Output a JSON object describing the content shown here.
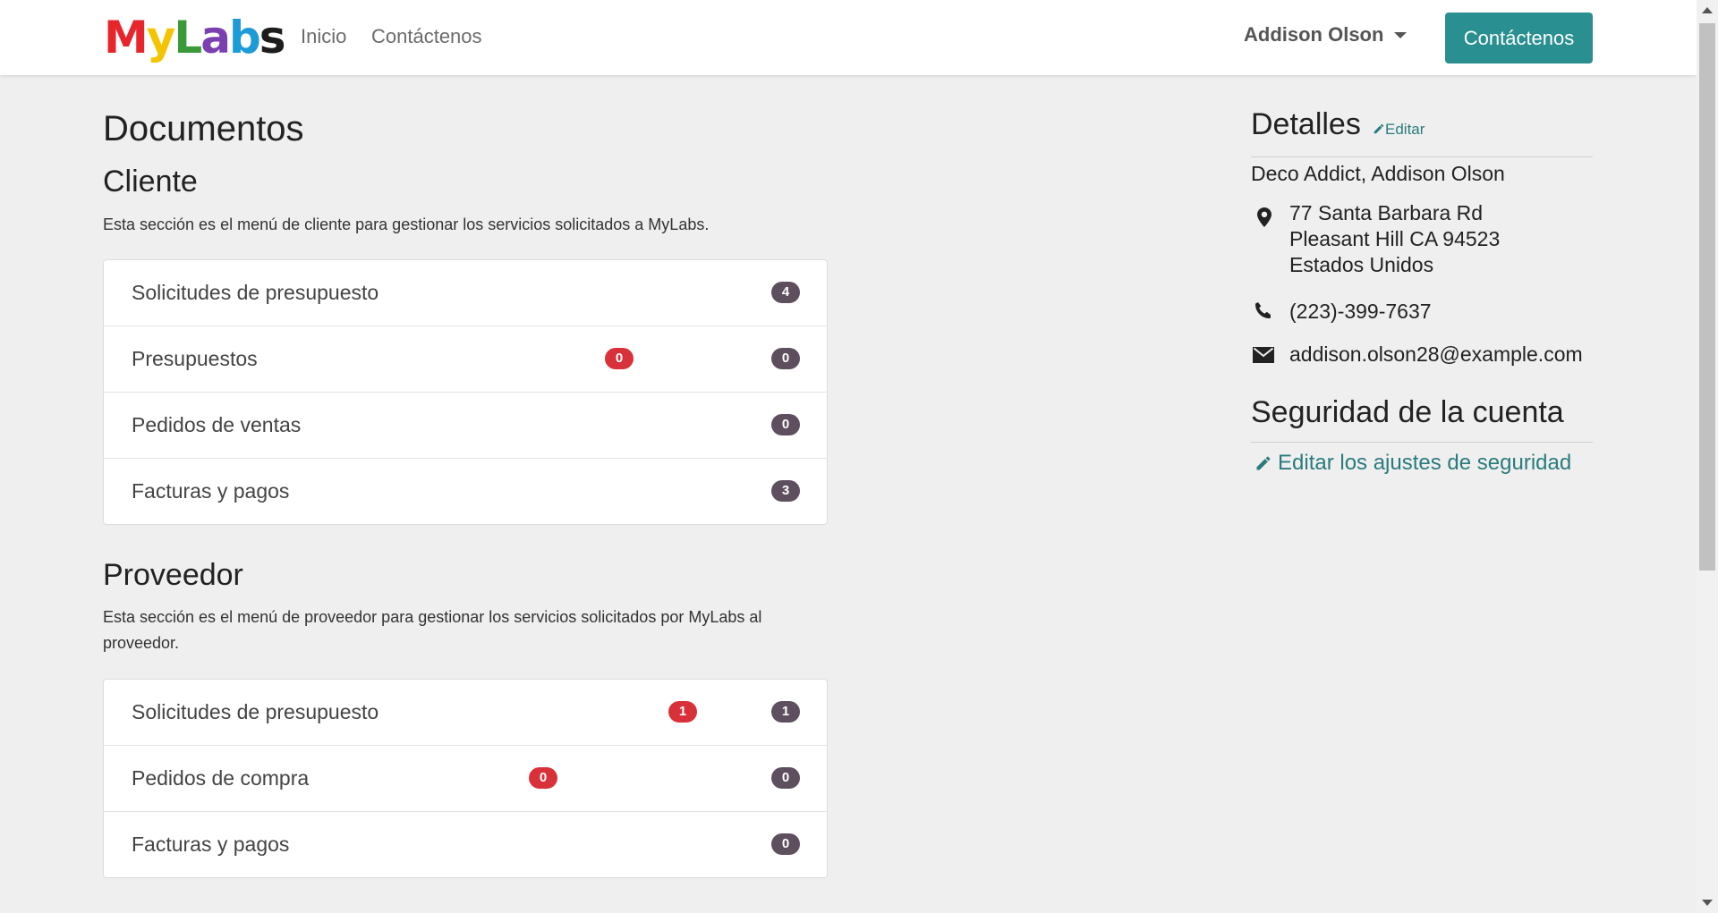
{
  "logo": {
    "letters": [
      "M",
      "y",
      "L",
      "a",
      "b",
      "s"
    ],
    "colors": [
      "#e8252b",
      "#f5c400",
      "#3a9a3a",
      "#7b3fb0",
      "#1d9bd6",
      "#1d1d1d"
    ]
  },
  "nav": {
    "home": "Inicio",
    "contact": "Contáctenos"
  },
  "user_menu": {
    "name": "Addison Olson"
  },
  "cta": {
    "label": "Contáctenos"
  },
  "page_title": "Documentos",
  "client": {
    "title": "Cliente",
    "description": "Esta sección es el menú de cliente para gestionar los servicios solicitados a MyLabs.",
    "items": [
      {
        "label": "Solicitudes de presupuesto",
        "count": "4"
      },
      {
        "label": "Presupuestos",
        "alert": "0",
        "count": "0"
      },
      {
        "label": "Pedidos de ventas",
        "count": "0"
      },
      {
        "label": "Facturas y pagos",
        "count": "3"
      }
    ]
  },
  "vendor": {
    "title": "Proveedor",
    "description": "Esta sección es el menú de proveedor para gestionar los servicios solicitados por MyLabs al proveedor.",
    "items": [
      {
        "label": "Solicitudes de presupuesto",
        "alert": "1",
        "count": "1"
      },
      {
        "label": "Pedidos de compra",
        "alert": "0",
        "count": "0"
      },
      {
        "label": "Facturas y pagos",
        "count": "0"
      }
    ]
  },
  "details": {
    "title": "Detalles",
    "edit": "Editar",
    "name": "Deco Addict, Addison Olson",
    "address": [
      "77 Santa Barbara Rd",
      "Pleasant Hill CA 94523",
      "Estados Unidos"
    ],
    "phone": "(223)-399-7637",
    "email": "addison.olson28@example.com"
  },
  "security": {
    "title": "Seguridad de la cuenta",
    "edit_link": "Editar los ajustes de seguridad"
  },
  "colors": {
    "accent": "#2a8f90",
    "badge_dark": "#5e4f5e",
    "badge_red": "#d9313a"
  }
}
